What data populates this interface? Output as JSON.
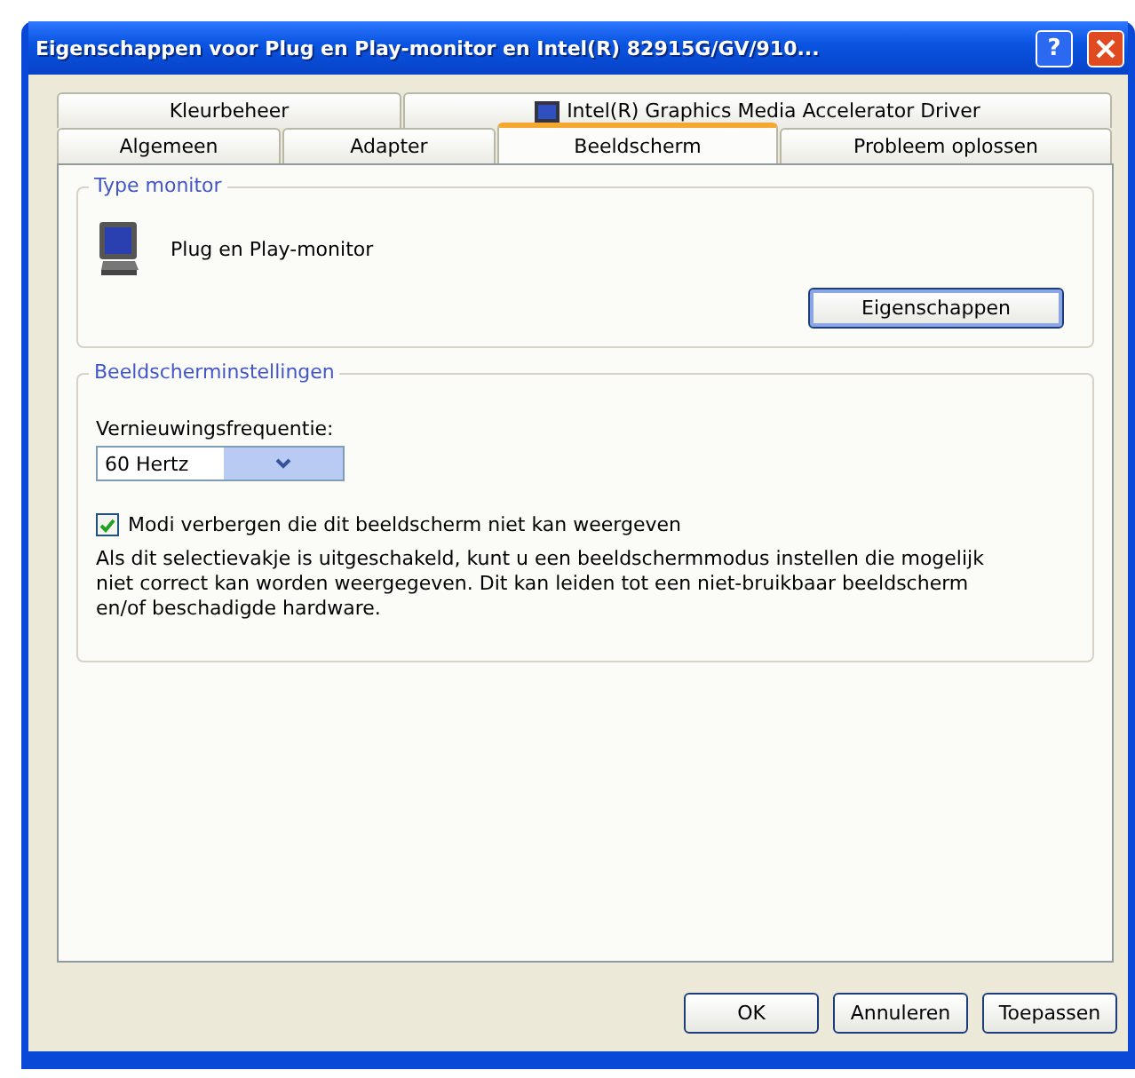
{
  "window": {
    "title": "Eigenschappen voor Plug en Play-monitor en Intel(R) 82915G/GV/910...",
    "help_button": "?"
  },
  "tab_rows": [
    {
      "tabs": [
        {
          "label": "Kleurbeheer",
          "selected": false,
          "has_icon": false
        },
        {
          "label": "Intel(R) Graphics Media Accelerator Driver",
          "selected": false,
          "has_icon": true
        }
      ]
    },
    {
      "tabs": [
        {
          "label": "Algemeen",
          "selected": false,
          "has_icon": false
        },
        {
          "label": "Adapter",
          "selected": false,
          "has_icon": false
        },
        {
          "label": "Beeldscherm",
          "selected": true,
          "has_icon": false
        },
        {
          "label": "Probleem oplossen",
          "selected": false,
          "has_icon": false
        }
      ]
    }
  ],
  "monitor_type": {
    "legend": "Type monitor",
    "name": "Plug en Play-monitor",
    "button": "Eigenschappen"
  },
  "settings": {
    "legend": "Beeldscherminstellingen",
    "refresh_label": "Vernieuwingsfrequentie:",
    "refresh_value": "60 Hertz",
    "hide_modes": {
      "label": "Modi verbergen die dit beeldscherm niet kan weergeven",
      "checked": true
    },
    "note": "Als dit selectievakje is uitgeschakeld, kunt u een beeldschermmodus instellen die mogelijk niet correct kan worden weergegeven. Dit kan leiden tot een niet-bruikbaar beeldscherm en/of beschadigde hardware."
  },
  "buttons": [
    "OK",
    "Annuleren",
    "Toepassen"
  ]
}
